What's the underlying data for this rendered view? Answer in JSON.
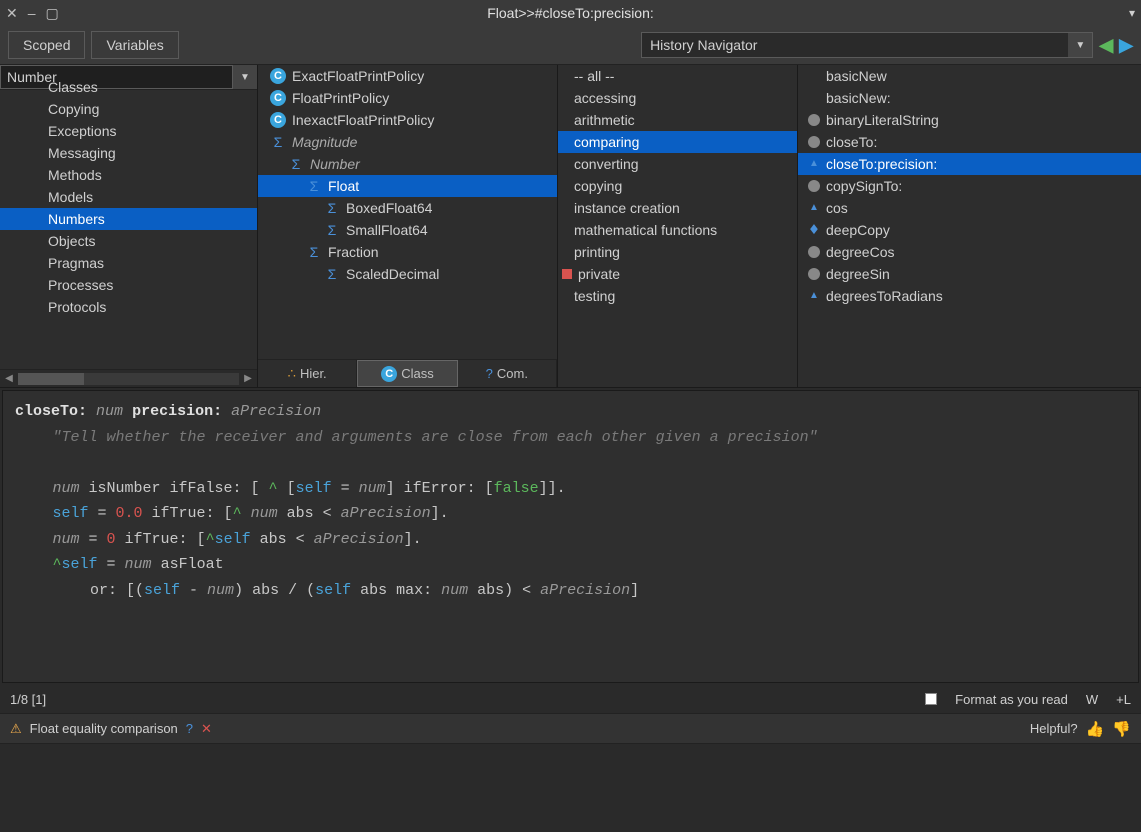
{
  "window": {
    "title": "Float>>#closeTo:precision:"
  },
  "toolbar": {
    "scoped_label": "Scoped",
    "variables_label": "Variables",
    "history_navigator_label": "History Navigator"
  },
  "filter": {
    "package_value": "Number"
  },
  "packages": {
    "items": [
      "Classes",
      "Copying",
      "Exceptions",
      "Messaging",
      "Methods",
      "Models",
      "Numbers",
      "Objects",
      "Pragmas",
      "Processes",
      "Protocols"
    ],
    "selected_index": 6
  },
  "classes": {
    "items": [
      {
        "label": "ExactFloatPrintPolicy",
        "kind": "class",
        "indent": 0
      },
      {
        "label": "FloatPrintPolicy",
        "kind": "class",
        "indent": 0
      },
      {
        "label": "InexactFloatPrintPolicy",
        "kind": "class",
        "indent": 0
      },
      {
        "label": "Magnitude",
        "kind": "sigma",
        "indent": 0,
        "italic": true
      },
      {
        "label": "Number",
        "kind": "sigma",
        "indent": 1,
        "italic": true
      },
      {
        "label": "Float",
        "kind": "sigma",
        "indent": 2,
        "selected": true
      },
      {
        "label": "BoxedFloat64",
        "kind": "sigma",
        "indent": 3
      },
      {
        "label": "SmallFloat64",
        "kind": "sigma",
        "indent": 3
      },
      {
        "label": "Fraction",
        "kind": "sigma",
        "indent": 2
      },
      {
        "label": "ScaledDecimal",
        "kind": "sigma",
        "indent": 3
      }
    ],
    "tabs": {
      "hier_label": "Hier.",
      "class_label": "Class",
      "com_label": "Com.",
      "active": "class"
    }
  },
  "protocols": {
    "items": [
      {
        "label": "-- all --"
      },
      {
        "label": "accessing"
      },
      {
        "label": "arithmetic"
      },
      {
        "label": "comparing",
        "selected": true
      },
      {
        "label": "converting"
      },
      {
        "label": "copying"
      },
      {
        "label": "instance creation"
      },
      {
        "label": "mathematical functions"
      },
      {
        "label": "printing"
      },
      {
        "label": "private",
        "flag": "private"
      },
      {
        "label": "testing"
      }
    ]
  },
  "methods": {
    "items": [
      {
        "label": "basicNew",
        "icon": "none"
      },
      {
        "label": "basicNew:",
        "icon": "none"
      },
      {
        "label": "binaryLiteralString",
        "icon": "circle"
      },
      {
        "label": "closeTo:",
        "icon": "circle"
      },
      {
        "label": "closeTo:precision:",
        "icon": "up",
        "selected": true
      },
      {
        "label": "copySignTo:",
        "icon": "circle"
      },
      {
        "label": "cos",
        "icon": "up"
      },
      {
        "label": "deepCopy",
        "icon": "updown"
      },
      {
        "label": "degreeCos",
        "icon": "circle"
      },
      {
        "label": "degreeSin",
        "icon": "circle"
      },
      {
        "label": "degreesToRadians",
        "icon": "up"
      }
    ]
  },
  "code": {
    "raw": "closeTo: num precision: aPrecision\n\t\"Tell whether the receiver and arguments are close from each other given a precision\"\n\n\tnum isNumber ifFalse: [ ^ [self = num] ifError: [false]].\n\tself = 0.0 ifTrue: [^ num abs < aPrecision].\n\tnum = 0 ifTrue: [^self abs < aPrecision].\n\t^self = num asFloat\n\t\tor: [(self - num) abs / (self abs max: num abs) < aPrecision]"
  },
  "status": {
    "position_label": "1/8 [1]",
    "format_label": "Format as you read",
    "w_label": "W",
    "l_label": "+L"
  },
  "warning": {
    "text": "Float equality comparison",
    "helpful_label": "Helpful?"
  }
}
